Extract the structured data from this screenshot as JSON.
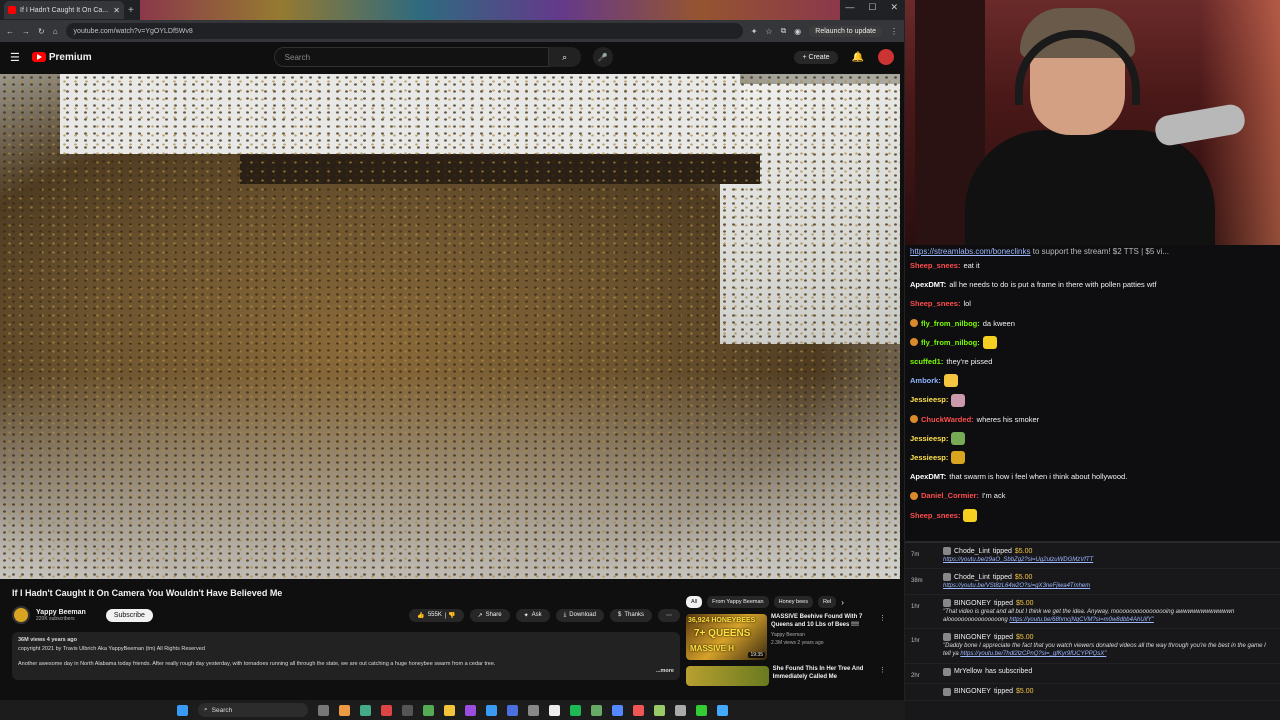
{
  "browser": {
    "tab_title": "If I Hadn't Caught It On Ca...",
    "url": "youtube.com/watch?v=YgOYLDf5Wv8",
    "relaunch_label": "Relaunch to update"
  },
  "yt": {
    "logo_text": "Premium",
    "search_placeholder": "Search",
    "create_label": "Create"
  },
  "video": {
    "title": "If I Hadn't Caught It On Camera You Wouldn't Have Believed Me",
    "channel": "Yappy Beeman",
    "subscribers": "220K subscribers",
    "subscribe_label": "Subscribe",
    "likes": "555K",
    "share_label": "Share",
    "ask_label": "Ask",
    "download_label": "Download",
    "thanks_label": "Thanks",
    "stats": "36M views  4 years ago",
    "copyright": "copyright 2021 by Travis Ulbrich Aka YappyBeeman (tm) All Rights Reserved",
    "description": "Another awesome day in North Alabama today friends.    After  really rough day yesterday, with tornadoes running all through the state, we are out catching a huge honeybee swarm from a cedar tree.",
    "more_label": "...more"
  },
  "related": {
    "chips": [
      "All",
      "From Yappy Beeman",
      "Honey bees",
      "Rel"
    ],
    "items": [
      {
        "title": "MASSIVE Beehive Found With 7 Queens and 10 Lbs of Bees !!!!",
        "channel": "Yappy Beeman",
        "stats": "2.3M views  2 years ago",
        "thumb_line1": "36,924 HONEYBEES",
        "thumb_line2": "7+ QUEENS",
        "thumb_line3": "MASSIVE H",
        "duration": "19:35"
      },
      {
        "title": "She Found This In Her Tree And Immediately Called Me",
        "channel": "",
        "stats": ""
      }
    ]
  },
  "taskbar": {
    "search_label": "Search"
  },
  "chat": {
    "banner_link": "https://streamlabs.com/boneclinks",
    "banner_text": " to support the stream! $2 TTS | $5 vi...",
    "messages": [
      {
        "user": "Sheep_snees:",
        "text": "eat it",
        "color": "#ff4d4d"
      },
      {
        "user": "ApexDMT:",
        "text": "all he needs to do is put a frame in there with pollen patties wtf",
        "color": "#ffffff"
      },
      {
        "user": "Sheep_snees:",
        "text": "lol",
        "color": "#ff4d4d"
      },
      {
        "user": "fly_from_nilbog:",
        "text": "da kween",
        "color": "#7cfc00"
      },
      {
        "user": "fly_from_nilbog:",
        "text": "",
        "color": "#7cfc00"
      },
      {
        "user": "scuffed1:",
        "text": "they're pissed",
        "color": "#7cfc00"
      },
      {
        "user": "Ambork:",
        "text": "",
        "color": "#8fb3ff"
      },
      {
        "user": "Jessieesp:",
        "text": "",
        "color": "#ffe14d"
      },
      {
        "user": "ChuckWarded:",
        "text": "wheres his smoker",
        "color": "#ff4d4d"
      },
      {
        "user": "Jessieesp:",
        "text": "",
        "color": "#ffe14d"
      },
      {
        "user": "Jessieesp:",
        "text": "",
        "color": "#ffe14d"
      },
      {
        "user": "ApexDMT:",
        "text": "that swarm is how i feel when i think about hollywood.",
        "color": "#ffffff"
      },
      {
        "user": "Daniel_Cormier:",
        "text": "I'm     ack",
        "color": "#ff4d4d"
      },
      {
        "user": "Sheep_snees:",
        "text": "",
        "color": "#ff4d4d"
      }
    ]
  },
  "events": [
    {
      "time": "7m",
      "user": "Chode_Lint",
      "action": "tipped",
      "amount": "$5.00",
      "message": "",
      "link": "https://youtu.be/z9aO_SbbZg2?si=Ug2ulzuWDGMzVfTT"
    },
    {
      "time": "38m",
      "user": "Chode_Lint",
      "action": "tipped",
      "amount": "$5.00",
      "message": "",
      "link": "https://youtu.be/VSt8zL64w2O?si=gX3neFjiwa4Tmhem"
    },
    {
      "time": "1hr",
      "user": "BINGONEY",
      "action": "tipped",
      "amount": "$5.00",
      "message": "\"That video is great and all but I think we get the idea. Anyway, moooooooooooooooing awwwwwwwwwwwwn aloooooooooooooooong",
      "link": "https://youtu.be/68hmcjNqCVM?si=m0w8dbb4AhUifY\""
    },
    {
      "time": "1hr",
      "user": "BINGONEY",
      "action": "tipped",
      "amount": "$5.00",
      "message": "\"Daddy bone I appreciate the fact that you watch viewers donated videos all the way through you're the best in the game I tell ya",
      "link": "https://youtu.be/7hdl2lzCPnQ?si=_gfKyr9fUCYPPQsX\""
    },
    {
      "time": "2hr",
      "user": "MrYellow",
      "action": "has subscribed",
      "amount": "",
      "message": "",
      "link": ""
    },
    {
      "time": "",
      "user": "BINGONEY",
      "action": "tipped",
      "amount": "$5.00",
      "message": "",
      "link": ""
    }
  ],
  "colors": {
    "yt_red": "#ff0000",
    "link_blue": "#9db8ff",
    "tip_gold": "#f5c542"
  }
}
